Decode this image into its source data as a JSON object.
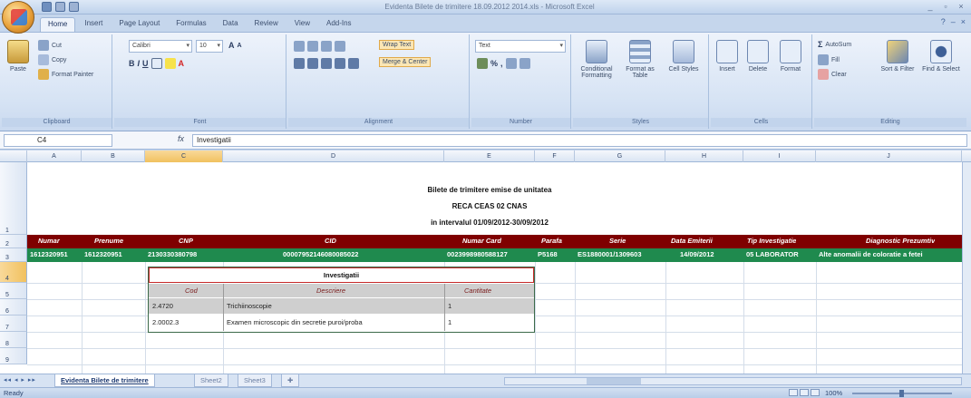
{
  "window": {
    "title": "Evidenta Bilete de trimitere 18.09.2012 2014.xls - Microsoft Excel",
    "controls": [
      "_",
      "▫",
      "×"
    ]
  },
  "ribbon_tabs": [
    "Home",
    "Insert",
    "Page Layout",
    "Formulas",
    "Data",
    "Review",
    "View",
    "Add-Ins"
  ],
  "ribbon": {
    "clipboard": {
      "label": "Clipboard",
      "paste": "Paste",
      "cut": "Cut",
      "copy": "Copy",
      "format_painter": "Format Painter"
    },
    "font": {
      "label": "Font",
      "font_name": "Calibri",
      "font_size": "10"
    },
    "alignment": {
      "label": "Alignment",
      "wrap_text": "Wrap Text",
      "merge_center": "Merge & Center"
    },
    "number": {
      "label": "Number",
      "format": "Text"
    },
    "styles": {
      "label": "Styles",
      "conditional": "Conditional Formatting",
      "format_table": "Format as Table",
      "cell_styles": "Cell Styles"
    },
    "cells": {
      "label": "Cells",
      "insert": "Insert",
      "delete": "Delete",
      "format": "Format"
    },
    "editing": {
      "label": "Editing",
      "autosum": "AutoSum",
      "fill": "Fill",
      "clear": "Clear",
      "sort_filter": "Sort & Filter",
      "find_select": "Find & Select"
    }
  },
  "formula_bar": {
    "name_box": "C4",
    "fx": "fx",
    "content": "Investigatii"
  },
  "columns": [
    "A",
    "B",
    "C",
    "D",
    "E",
    "F",
    "G",
    "H",
    "I",
    "J"
  ],
  "rows": [
    "1",
    "2",
    "3",
    "4",
    "5",
    "6",
    "7",
    "8",
    "9"
  ],
  "title_lines": [
    "Bilete de trimitere emise de unitatea",
    "RECA CEAS 02 CNAS",
    "in intervalul 01/09/2012-30/09/2012"
  ],
  "header_row": [
    "Numar",
    "Prenume",
    "CNP",
    "CID",
    "Numar Card",
    "Parafa",
    "Serie",
    "Data Emiterii",
    "Tip Investigatie",
    "Diagnostic Prezumtiv"
  ],
  "data_row": [
    "1612320951",
    "1612320951",
    "2130330380798",
    "00007952146080085022",
    "0023998980588127",
    "P5168",
    "ES1880001/1309603",
    "14/09/2012",
    "05 LABORATOR",
    "Alte anomalii de coloratie a fetei"
  ],
  "popup": {
    "title": "Investigatii",
    "headers": [
      "Cod",
      "Descriere",
      "Cantitate"
    ],
    "rows": [
      [
        "2.4720",
        "Trichiinoscopie",
        "1"
      ],
      [
        "2.0002.3",
        "Examen microscopic din secretie puroi/proba",
        "1"
      ]
    ]
  },
  "sheet_tabs": [
    "Evidenta Bilete de trimitere",
    "Sheet2",
    "Sheet3"
  ],
  "status": {
    "text": "Ready",
    "zoom": "100%"
  },
  "colors": {
    "header_bg": "#7f0000",
    "data_bg": "#1f8a4e",
    "selected_col": "#f3c96b"
  }
}
